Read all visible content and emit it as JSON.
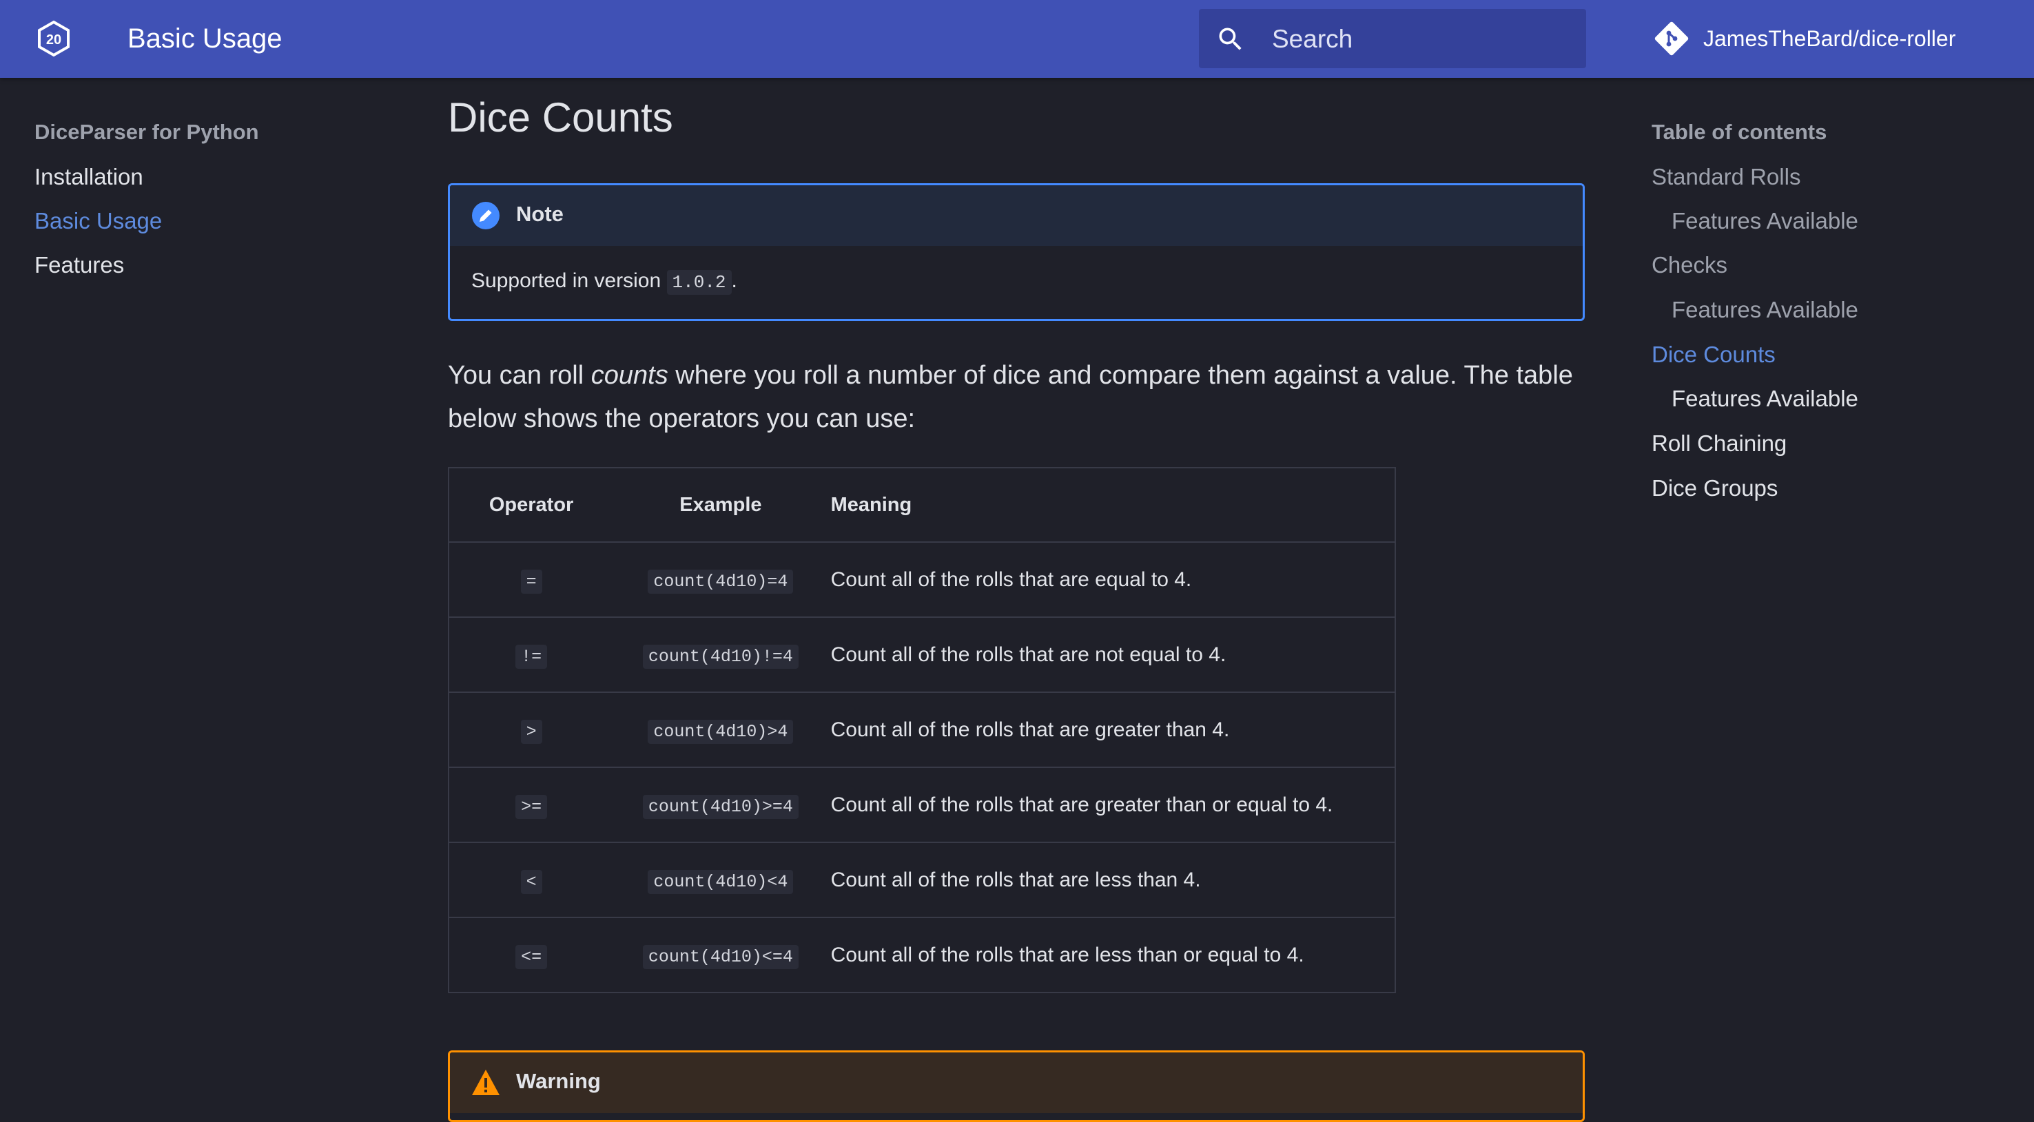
{
  "header": {
    "logo_label": "20",
    "title": "Basic Usage",
    "search_placeholder": "Search",
    "repo_name": "JamesTheBard/dice-roller"
  },
  "nav": {
    "section_title": "DiceParser for Python",
    "items": [
      {
        "label": "Installation",
        "active": false
      },
      {
        "label": "Basic Usage",
        "active": true
      },
      {
        "label": "Features",
        "active": false
      }
    ]
  },
  "main": {
    "title": "Dice Counts",
    "note": {
      "title": "Note",
      "text_prefix": "Supported in version",
      "version": "1.0.2",
      "text_suffix": "."
    },
    "intro": {
      "part1": "You can roll ",
      "emphasis": "counts",
      "part2": " where you roll a number of dice and compare them against a value. The table below shows the operators you can use:"
    },
    "table": {
      "headers": [
        "Operator",
        "Example",
        "Meaning"
      ],
      "rows": [
        {
          "operator": "=",
          "example": "count(4d10)=4",
          "meaning": "Count all of the rolls that are equal to 4."
        },
        {
          "operator": "!=",
          "example": "count(4d10)!=4",
          "meaning": "Count all of the rolls that are not equal to 4."
        },
        {
          "operator": ">",
          "example": "count(4d10)>4",
          "meaning": "Count all of the rolls that are greater than 4."
        },
        {
          "operator": ">=",
          "example": "count(4d10)>=4",
          "meaning": "Count all of the rolls that are greater than or equal to 4."
        },
        {
          "operator": "<",
          "example": "count(4d10)<4",
          "meaning": "Count all of the rolls that are less than 4."
        },
        {
          "operator": "<=",
          "example": "count(4d10)<=4",
          "meaning": "Count all of the rolls that are less than or equal to 4."
        }
      ]
    },
    "warning": {
      "title": "Warning"
    }
  },
  "toc": {
    "title": "Table of contents",
    "items": [
      {
        "label": "Standard Rolls",
        "level": 1,
        "state": "dim"
      },
      {
        "label": "Features Available",
        "level": 2,
        "state": "dim"
      },
      {
        "label": "Checks",
        "level": 1,
        "state": "dim"
      },
      {
        "label": "Features Available",
        "level": 2,
        "state": "dim"
      },
      {
        "label": "Dice Counts",
        "level": 1,
        "state": "active"
      },
      {
        "label": "Features Available",
        "level": 2,
        "state": "bright"
      },
      {
        "label": "Roll Chaining",
        "level": 1,
        "state": "bright"
      },
      {
        "label": "Dice Groups",
        "level": 1,
        "state": "bright"
      }
    ]
  },
  "colors": {
    "header_bg": "#4051b5",
    "page_bg": "#1f2029",
    "accent_link": "#5e8bde",
    "note_border": "#448aff",
    "warning_border": "#ff9100"
  },
  "icons": {
    "logo": "d20-icon",
    "search": "search-icon",
    "repo": "git-icon",
    "note": "pencil-icon",
    "warning": "warning-icon"
  }
}
